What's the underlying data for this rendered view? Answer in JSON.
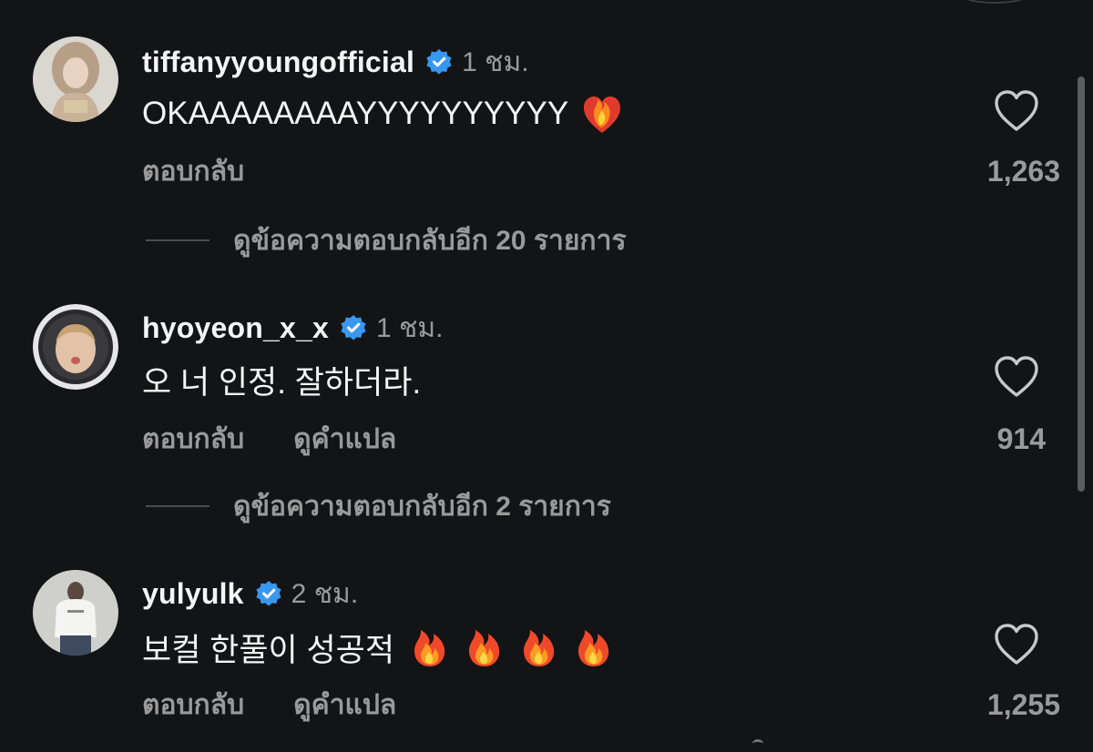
{
  "comments": [
    {
      "username": "tiffanyyoungofficial",
      "time": "1 ชม.",
      "text": "OKAAAAAAAAYYYYYYYYYY",
      "emojis": [
        "heart-on-fire-emoji"
      ],
      "reply_label": "ตอบกลับ",
      "translate_label": "",
      "likes": "1,263",
      "view_replies": "ดูข้อความตอบกลับอีก 20 รายการ"
    },
    {
      "username": "hyoyeon_x_x",
      "time": "1 ชม.",
      "text": "오 너 인정. 잘하더라.",
      "emojis": [],
      "reply_label": "ตอบกลับ",
      "translate_label": "ดูคำแปล",
      "likes": "914",
      "view_replies": "ดูข้อความตอบกลับอีก 2 รายการ"
    },
    {
      "username": "yulyulk",
      "time": "2 ชม.",
      "text": "보컬 한풀이 성공적",
      "emojis": [
        "fire-emoji",
        "fire-emoji",
        "fire-emoji",
        "fire-emoji"
      ],
      "reply_label": "ตอบกลับ",
      "translate_label": "ดูคำแปล",
      "likes": "1,255",
      "view_replies": ""
    }
  ],
  "colors": {
    "background": "#131416",
    "primary_text": "#f5f5f5",
    "secondary_text": "#9a9a9a",
    "verified_badge": "#3897f0"
  },
  "icons": {
    "verified": "verified-badge-icon",
    "like": "heart-outline-icon"
  }
}
